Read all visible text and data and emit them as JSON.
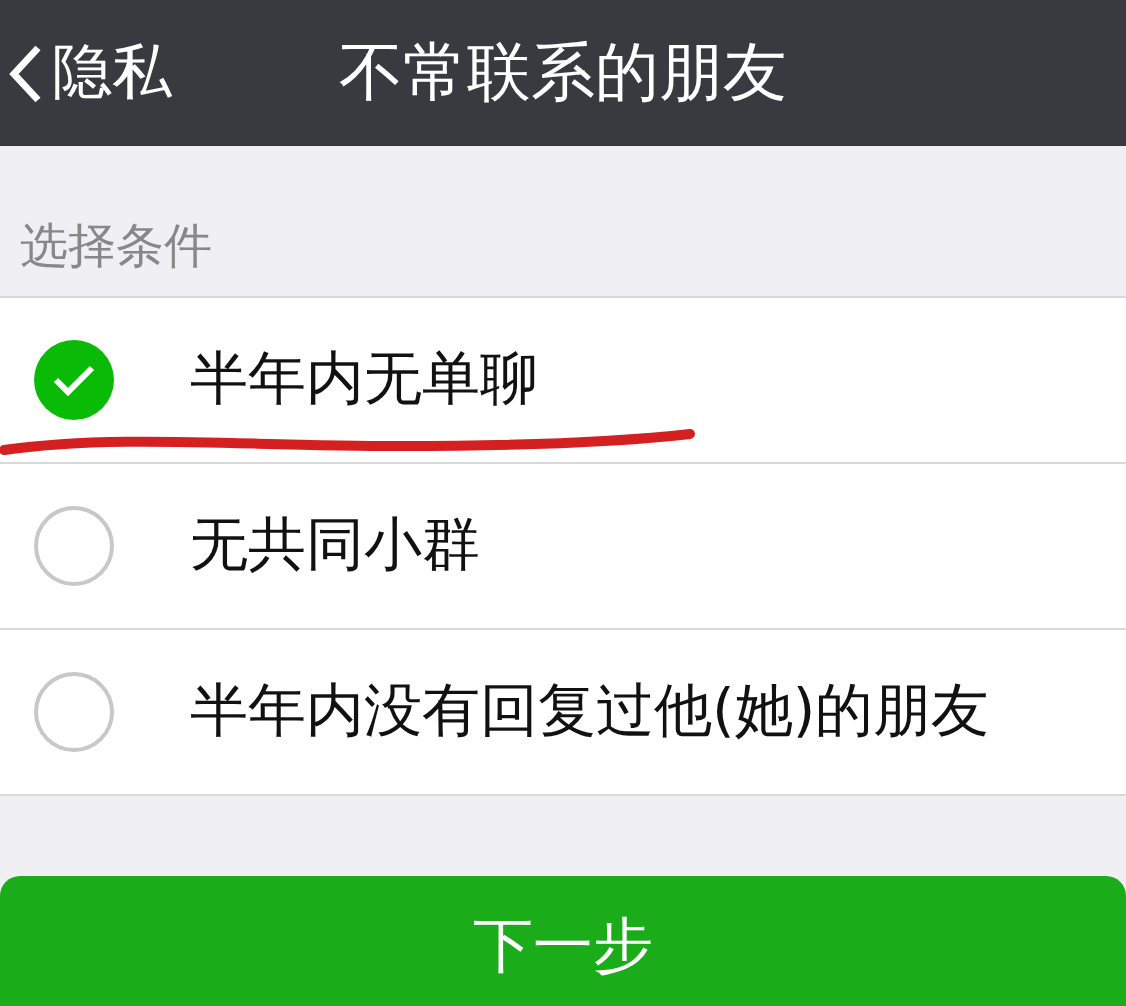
{
  "nav_bar": {
    "back_label": "隐私",
    "title": "不常联系的朋友"
  },
  "section": {
    "label": "选择条件"
  },
  "options": [
    {
      "label": "半年内无单聊",
      "selected": true,
      "underlined": true
    },
    {
      "label": "无共同小群",
      "selected": false,
      "underlined": false
    },
    {
      "label": "半年内没有回复过他(她)的朋友",
      "selected": false,
      "underlined": false
    }
  ],
  "next_button": {
    "label": "下一步"
  }
}
